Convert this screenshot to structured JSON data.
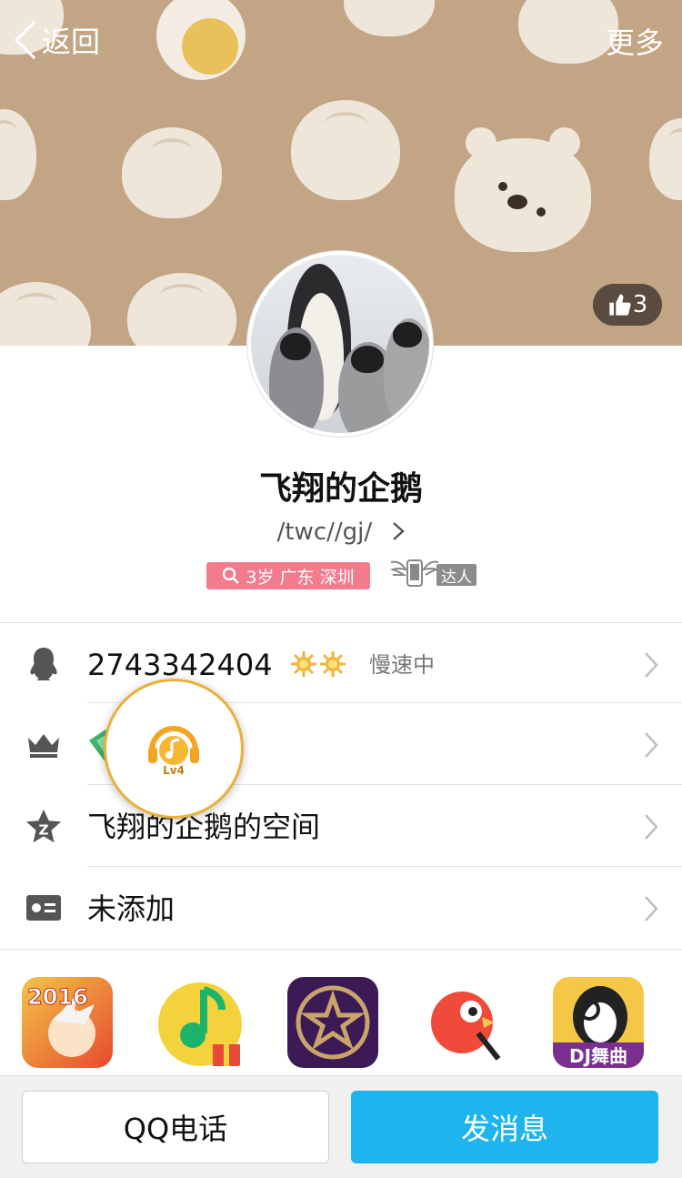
{
  "nav": {
    "back_label": "返回",
    "more_label": "更多"
  },
  "likes": {
    "count": "3"
  },
  "profile": {
    "nickname": "飞翔的企鹅",
    "signature": "/twc//gj/",
    "tag_text": "3岁 广东 深圳",
    "daren_label": "达人"
  },
  "rows": {
    "qq_number": "2743342404",
    "qq_status": "慢速中",
    "vip_level_label": "Lv4",
    "qzone_label": "飞翔的企鹅的空间",
    "card_label": "未添加"
  },
  "apps": [
    {
      "name": "2016"
    },
    {
      "name": "QQ音乐"
    },
    {
      "name": "全民K歌星"
    },
    {
      "name": "鹦鹉"
    },
    {
      "name": "DJ舞曲"
    }
  ],
  "footer": {
    "call_label": "QQ电话",
    "message_label": "发消息"
  },
  "colors": {
    "header_bg": "#c2a585",
    "accent_blue": "#1eb4ee",
    "tag_pink": "#f37b8c"
  }
}
